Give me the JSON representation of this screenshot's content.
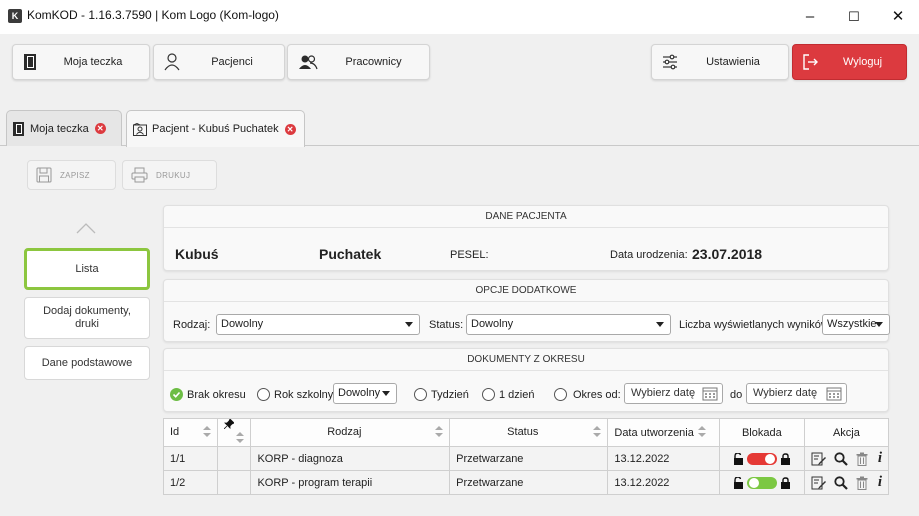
{
  "window": {
    "app_icon_letter": "K",
    "title": "KomKOD - 1.16.3.7590 | Kom Logo (Kom-logo)",
    "minimize": "–",
    "maximize": "☐",
    "close": "✕"
  },
  "nav": {
    "my_folder": "Moja teczka",
    "patients": "Pacjenci",
    "employees": "Pracownicy",
    "settings": "Ustawienia",
    "logout": "Wyloguj"
  },
  "tabs": [
    {
      "label": "Moja teczka"
    },
    {
      "label": "Pacjent - Kubuś Puchatek"
    }
  ],
  "toolbar": {
    "save": "ZAPISZ",
    "print": "DRUKUJ"
  },
  "sidebar": {
    "items": [
      {
        "label": "Lista"
      },
      {
        "label": "Dodaj dokumenty,\ndruki"
      },
      {
        "label": "Dane podstawowe"
      }
    ]
  },
  "patient": {
    "header": "DANE PACJENTA",
    "first_name": "Kubuś",
    "last_name": "Puchatek",
    "pesel_label": "PESEL:",
    "pesel_value": "",
    "dob_label": "Data urodzenia:",
    "dob_value": "23.07.2018"
  },
  "options": {
    "header": "OPCJE DODATKOWE",
    "type_label": "Rodzaj:",
    "type_value": "Dowolny",
    "status_label": "Status:",
    "status_value": "Dowolny",
    "count_label": "Liczba wyświetlanych wyników:",
    "count_value": "Wszystkie"
  },
  "period": {
    "header": "DOKUMENTY Z OKRESU",
    "no_period": "Brak okresu",
    "school_year": "Rok szkolny:",
    "school_year_value": "Dowolny",
    "week": "Tydzień",
    "day": "1 dzień",
    "range_from": "Okres od:",
    "date_placeholder": "Wybierz datę",
    "to": "do"
  },
  "table": {
    "columns": [
      "Id",
      "",
      "Rodzaj",
      "Status",
      "Data utworzenia",
      "Blokada",
      "Akcja"
    ],
    "rows": [
      {
        "id": "1/1",
        "type": "KORP - diagnoza",
        "status": "Przetwarzane",
        "created": "13.12.2022",
        "lock_on": true
      },
      {
        "id": "1/2",
        "type": "KORP - program terapii",
        "status": "Przetwarzane",
        "created": "13.12.2022",
        "lock_on": false
      }
    ]
  },
  "colors": {
    "logout_red": "#dc3a3f",
    "selected_green": "#8cc63f",
    "toggle_red": "#e53935",
    "toggle_green": "#7cc843",
    "radio_green": "#6dbd45"
  }
}
